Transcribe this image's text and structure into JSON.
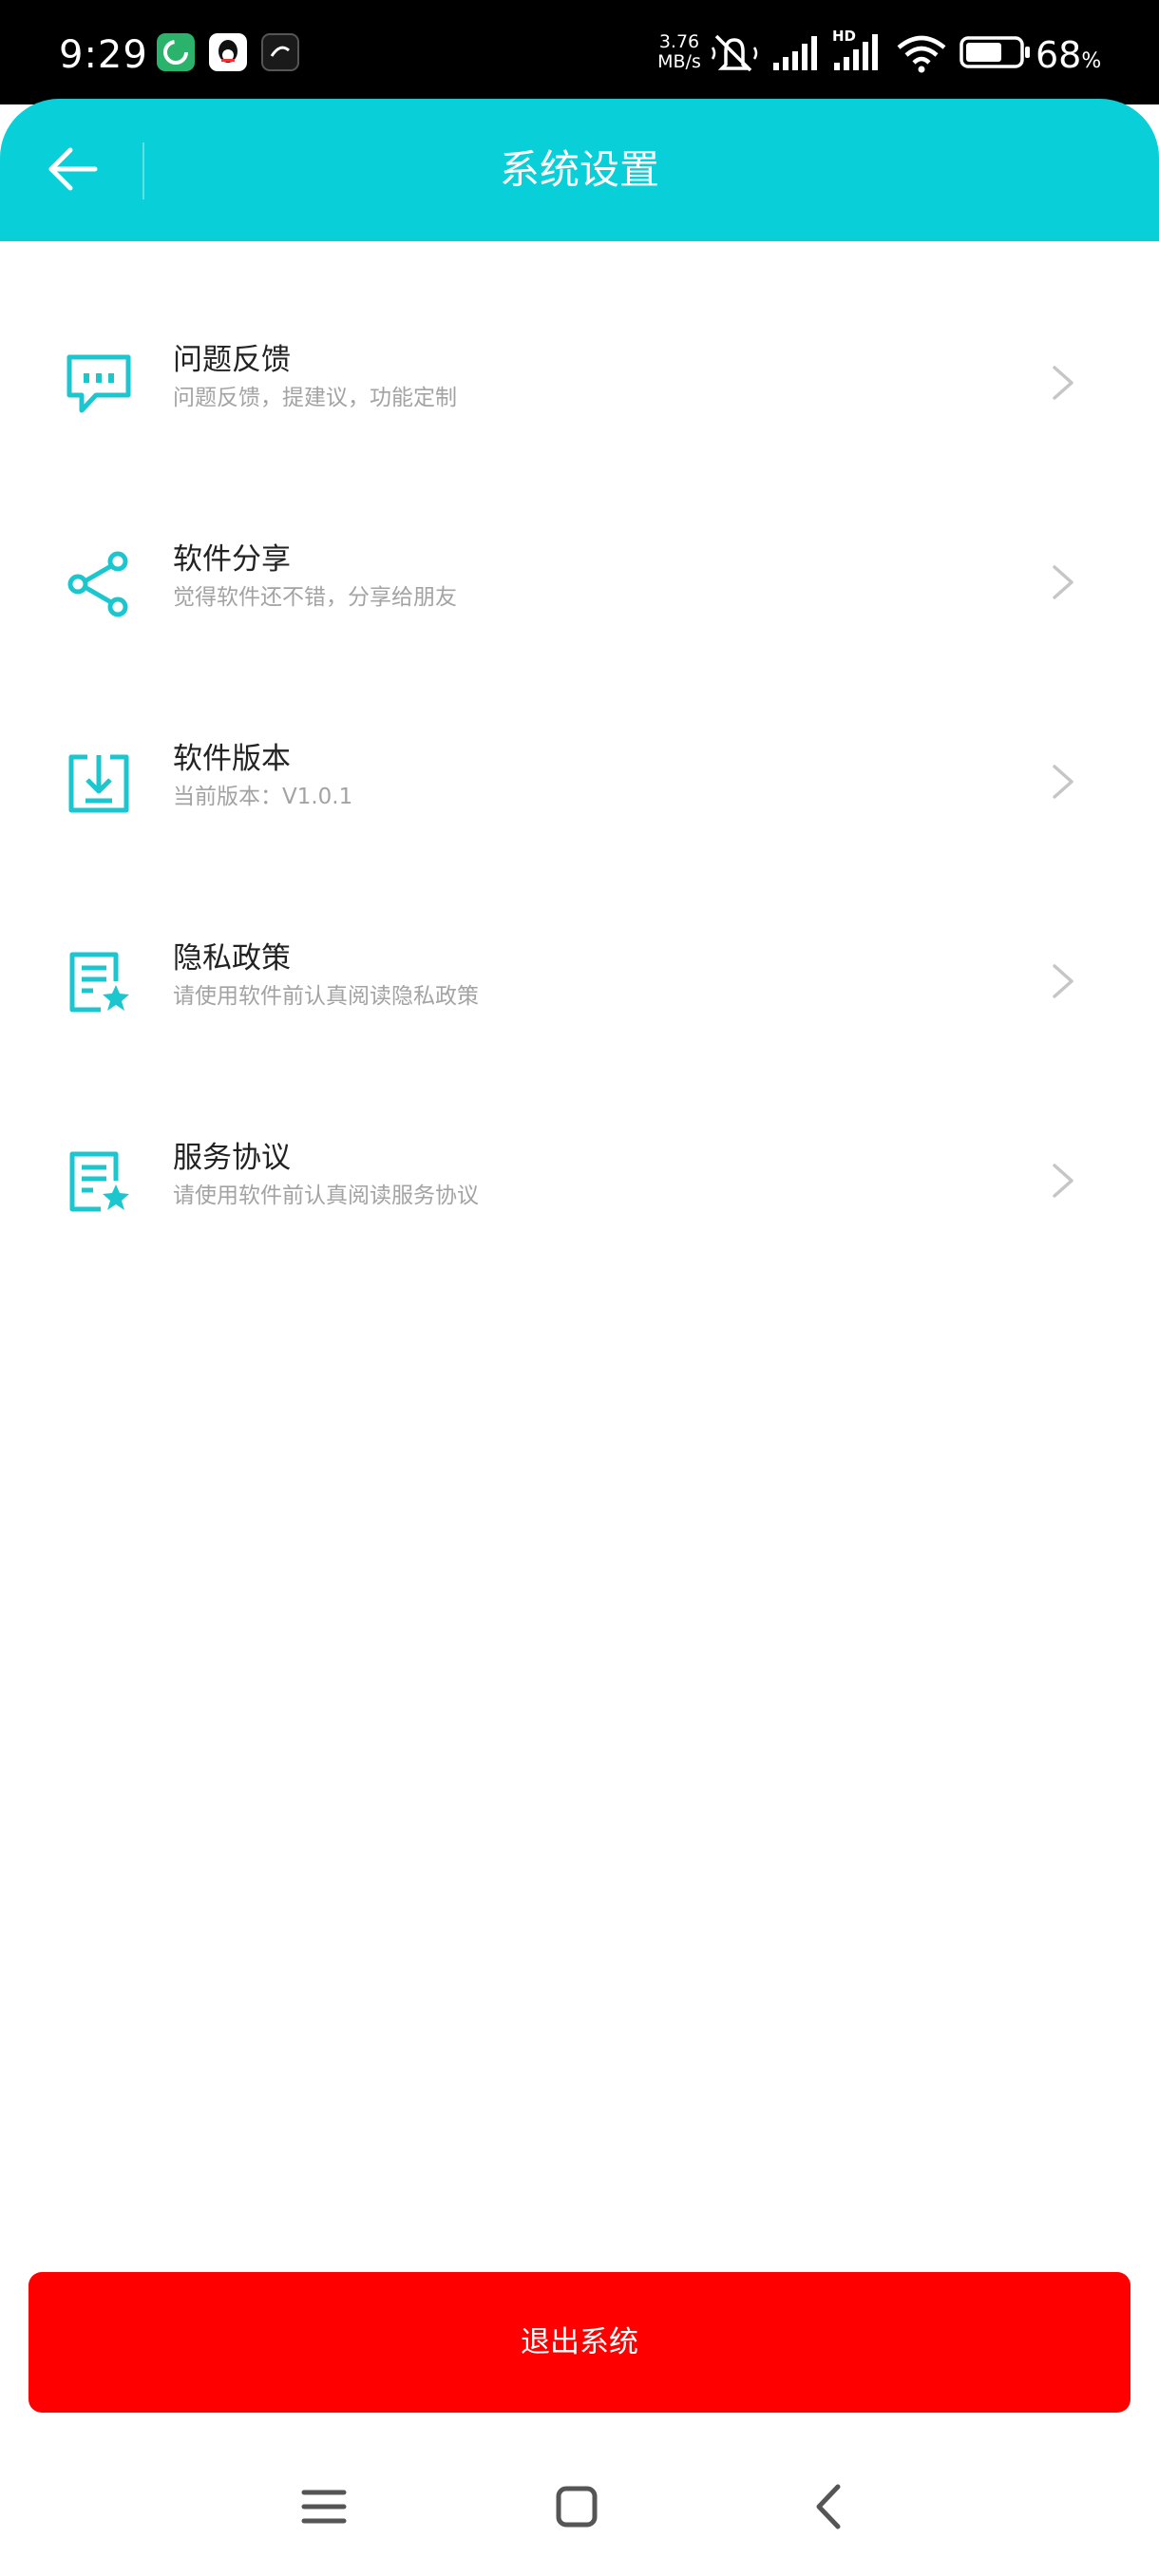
{
  "status_bar": {
    "time": "9:29",
    "net_speed_value": "3.76",
    "net_speed_unit": "MB/s",
    "network_label": "HD",
    "battery_value": "68",
    "battery_unit": "%",
    "battery_level": 0.68,
    "app_icons": [
      "green-app-icon",
      "qq-icon",
      "soul-icon"
    ]
  },
  "header": {
    "title": "系统设置",
    "back_icon": "arrow-left-icon",
    "background": "#08cfd8"
  },
  "settings": {
    "items": [
      {
        "icon": "feedback-chat-icon",
        "title": "问题反馈",
        "subtitle": "问题反馈，提建议，功能定制"
      },
      {
        "icon": "share-icon",
        "title": "软件分享",
        "subtitle": "觉得软件还不错，分享给朋友"
      },
      {
        "icon": "download-version-icon",
        "title": "软件版本",
        "subtitle": "当前版本：V1.0.1"
      },
      {
        "icon": "privacy-document-icon",
        "title": "隐私政策",
        "subtitle": "请使用软件前认真阅读隐私政策"
      },
      {
        "icon": "agreement-document-icon",
        "title": "服务协议",
        "subtitle": "请使用软件前认真阅读服务协议"
      }
    ],
    "chevron_icon": "chevron-right-icon"
  },
  "logout": {
    "label": "退出系统",
    "color": "#ff0000"
  },
  "nav": {
    "icons": [
      "menu-icon",
      "home-square-icon",
      "back-chevron-icon"
    ]
  },
  "colors": {
    "accent": "#08cfd8",
    "icon": "#1cc6cf",
    "danger": "#ff0000",
    "title_text": "#222222",
    "subtitle_text": "#a3a3a3",
    "chevron": "#c6c6c6"
  }
}
